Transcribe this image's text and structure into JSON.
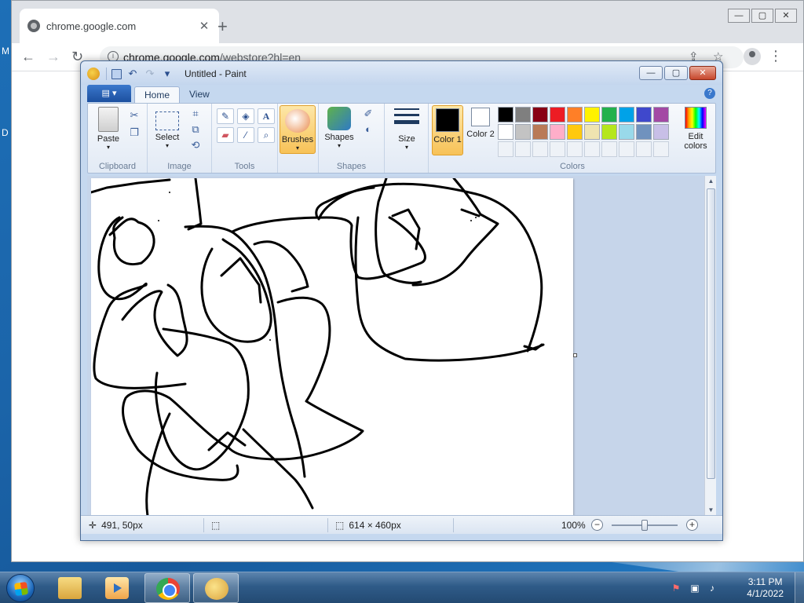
{
  "desktop": {
    "edge_letters": [
      "M",
      "D"
    ]
  },
  "browser": {
    "tab_title": "chrome.google.com",
    "new_tab_glyph": "+",
    "url_host": "chrome.google.com",
    "url_path": "/webstore?hl=en",
    "controls": {
      "minimize": "—",
      "maximize": "▢",
      "close": "✕"
    }
  },
  "paint": {
    "title": "Untitled - Paint",
    "tabs": {
      "home": "Home",
      "view": "View"
    },
    "groups": {
      "clipboard": "Clipboard",
      "image": "Image",
      "tools": "Tools",
      "shapes": "Shapes",
      "colors": "Colors"
    },
    "buttons": {
      "paste": "Paste",
      "select": "Select",
      "brushes": "Brushes",
      "shapes": "Shapes",
      "size": "Size",
      "color1": "Color 1",
      "color2": "Color 2",
      "edit_colors": "Edit colors"
    },
    "color1": "#000000",
    "color2": "#ffffff",
    "palette": [
      "#000000",
      "#7f7f7f",
      "#880015",
      "#ed1c24",
      "#ff7f27",
      "#fff200",
      "#22b14c",
      "#00a2e8",
      "#3f48cc",
      "#a349a4",
      "#ffffff",
      "#c3c3c3",
      "#b97a57",
      "#ffaec9",
      "#ffc90e",
      "#efe4b0",
      "#b5e61d",
      "#99d9ea",
      "#7092be",
      "#c8bfe7"
    ],
    "status": {
      "cursor_pos": "491, 50px",
      "canvas_size": "614 × 460px",
      "zoom": "100%",
      "zoom_level_fraction": 0.5
    }
  },
  "taskbar": {
    "time": "3:11 PM",
    "date": "4/1/2022"
  }
}
